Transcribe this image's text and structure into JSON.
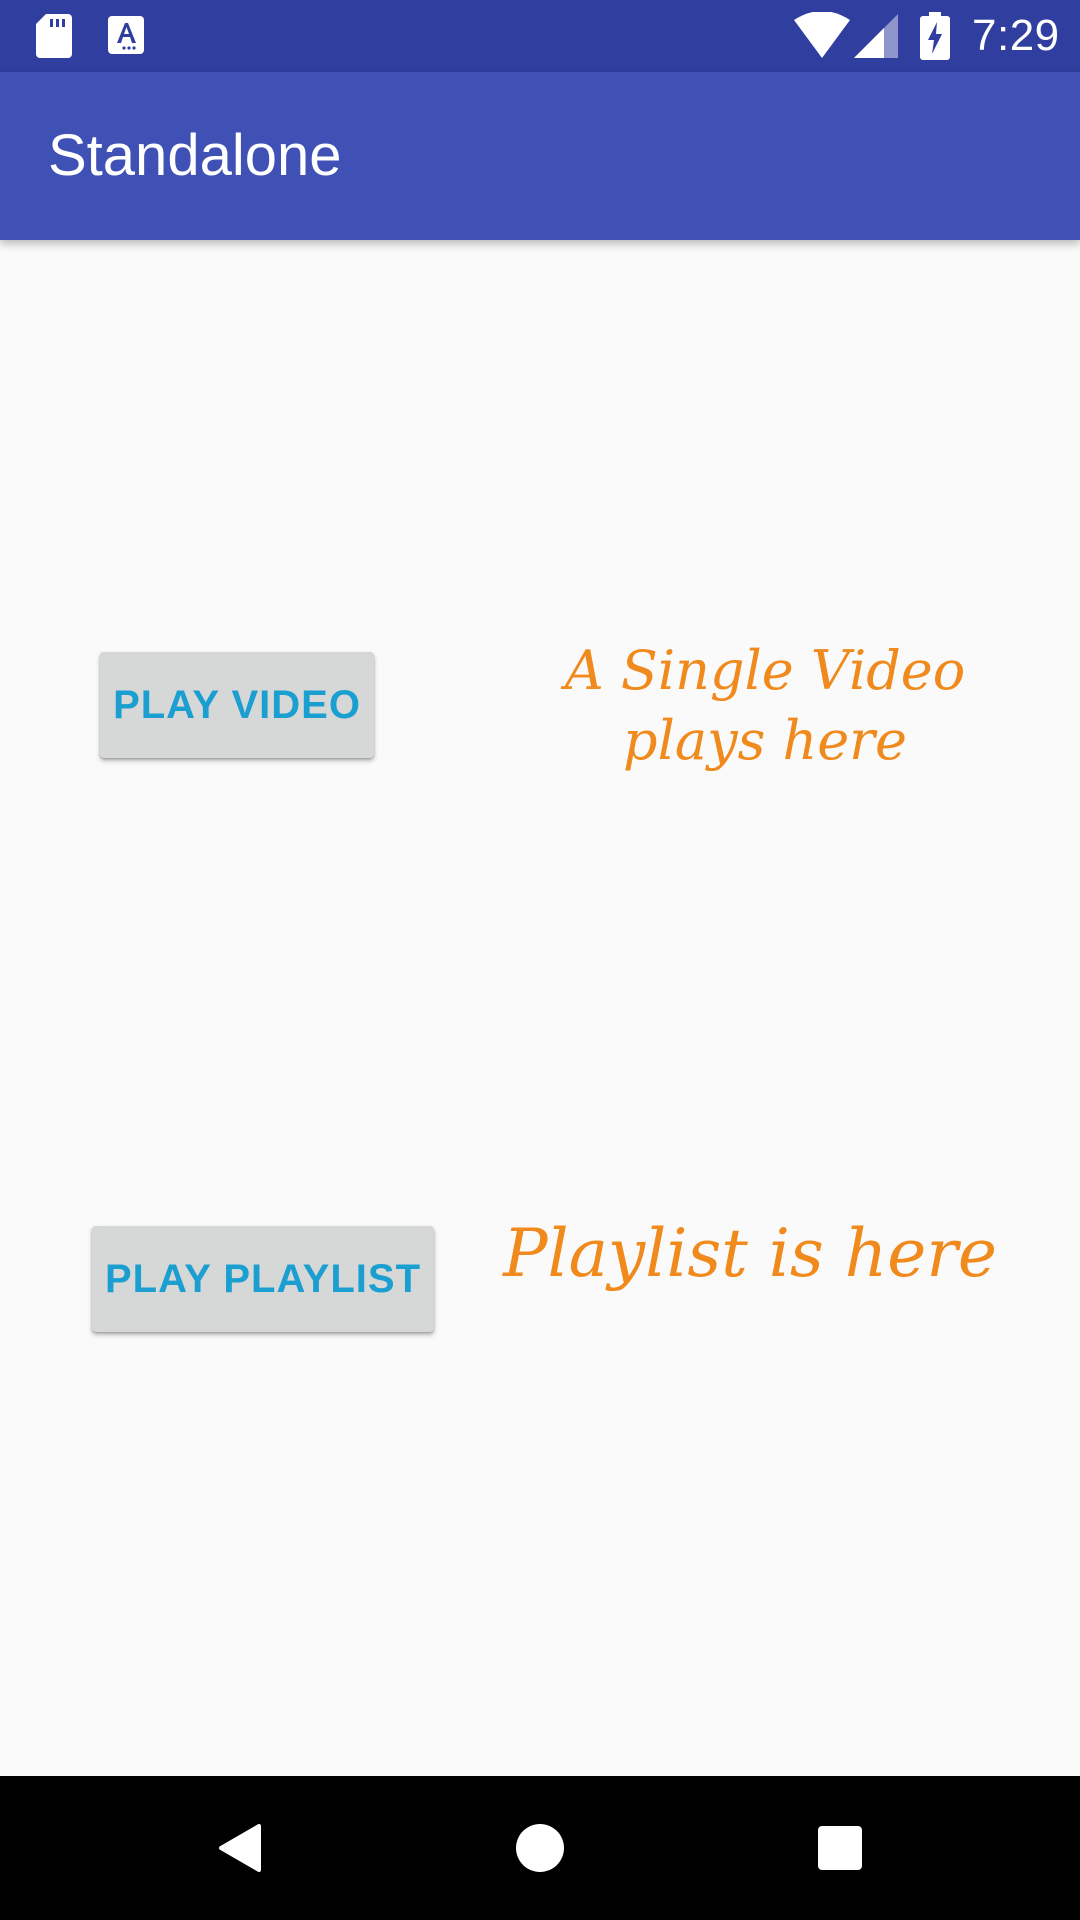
{
  "status_bar": {
    "time": "7:29",
    "icons": [
      "sd-card-icon",
      "a-notification-icon",
      "wifi-icon",
      "cell-signal-icon",
      "battery-charging-icon"
    ]
  },
  "app_bar": {
    "title": "Standalone",
    "color": "#3f51b5"
  },
  "main": {
    "play_video_label": "PLAY VIDEO",
    "video_caption": "A Single Video plays here",
    "play_playlist_label": "PLAY PLAYLIST",
    "playlist_caption": "Playlist is here"
  },
  "colors": {
    "status_bar": "#303f9f",
    "button_text": "#1a9fd0",
    "caption_text": "#f08a1c",
    "button_bg": "#d6d7d7"
  },
  "nav_bar": {
    "icons": [
      "back-icon",
      "home-icon",
      "recents-icon"
    ]
  }
}
